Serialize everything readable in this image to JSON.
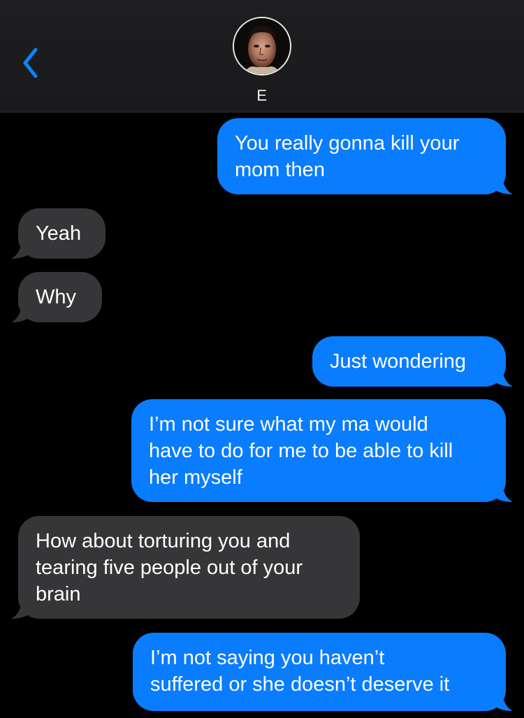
{
  "header": {
    "back_icon": "chevron-left-icon",
    "contact_name": "E",
    "accent_color": "#0a84ff"
  },
  "colors": {
    "sent_bubble": "#0a7cfe",
    "received_bubble": "#363638",
    "background": "#000000"
  },
  "messages": [
    {
      "direction": "sent",
      "text": "You really gonna kill your\nmom then"
    },
    {
      "direction": "received",
      "text": "Yeah"
    },
    {
      "direction": "received",
      "text": "Why"
    },
    {
      "direction": "sent",
      "text": "Just wondering"
    },
    {
      "direction": "sent",
      "text": "I’m not sure what my ma would\nhave to do for me to be able to kill\nher myself"
    },
    {
      "direction": "received",
      "text": "How about torturing you and\ntearing five people out of your\nbrain"
    },
    {
      "direction": "sent",
      "text": "I’m not saying you haven’t\nsuffered or she doesn’t deserve it"
    }
  ]
}
